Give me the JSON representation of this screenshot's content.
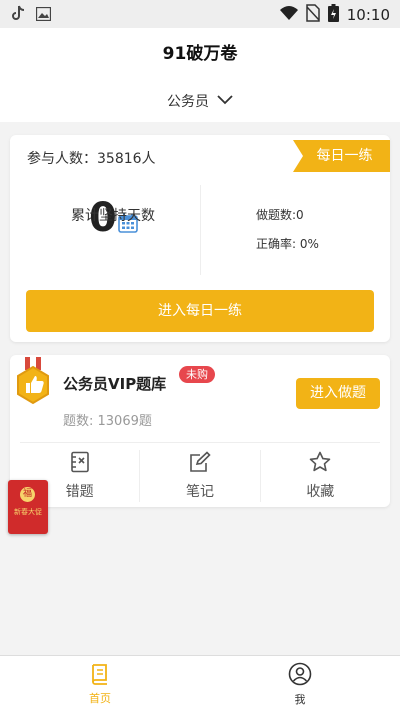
{
  "status_bar": {
    "time": "10:10"
  },
  "header": {
    "title": "91破万卷"
  },
  "category": {
    "selected": "公务员"
  },
  "daily_card": {
    "participants": "参与人数：35816人",
    "ribbon": "每日一练",
    "streak_value": "0",
    "streak_label": "累计坚持天数",
    "done_label": "做题数:0",
    "accuracy_label": "正确率: 0%",
    "button": "进入每日一练"
  },
  "vip_card": {
    "title": "公务员VIP题库",
    "badge": "未购",
    "count": "题数: 13069题",
    "button": "进入做题",
    "tools": [
      {
        "label": "错题",
        "icon": "wrong-questions-icon"
      },
      {
        "label": "笔记",
        "icon": "note-edit-icon"
      },
      {
        "label": "收藏",
        "icon": "star-icon"
      }
    ]
  },
  "promo": {
    "seal": "福",
    "text": "新春大促"
  },
  "tabs": [
    {
      "label": "首页",
      "icon": "home-book-icon",
      "active": true
    },
    {
      "label": "我",
      "icon": "profile-icon",
      "active": false
    }
  ],
  "colors": {
    "accent": "#f2b316",
    "badge": "#e7474d",
    "promo": "#d02b2b"
  }
}
